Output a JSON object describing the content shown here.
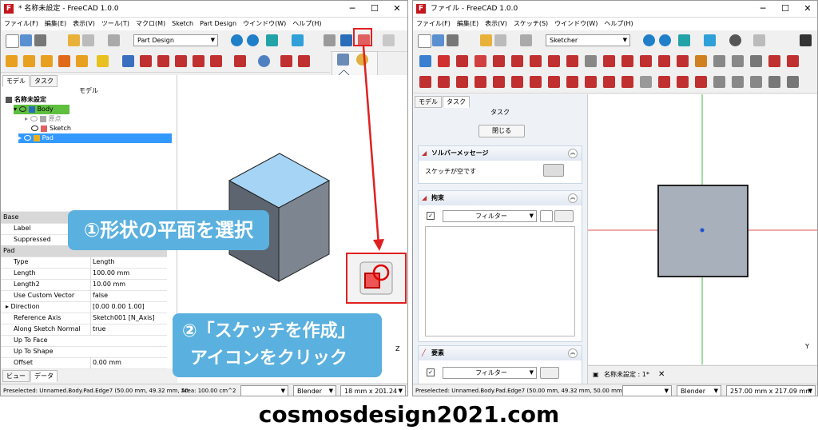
{
  "left": {
    "title": "* 名称未設定 - FreeCAD 1.0.0",
    "menu": [
      "ファイル(F)",
      "編集(E)",
      "表示(V)",
      "ツール(T)",
      "マクロ(M)",
      "Sketch",
      "Part Design",
      "ウインドウ(W)",
      "ヘルプ(H)"
    ],
    "workbench": "Part Design",
    "tabs": [
      "モデル",
      "タスク"
    ],
    "panel_title": "モデル",
    "tree": {
      "doc": "名称未設定",
      "body": "Body",
      "origin": "原点",
      "sketch": "Sketch",
      "pad": "Pad"
    },
    "props": [
      {
        "group": "Base"
      },
      {
        "k": "Label",
        "v": ""
      },
      {
        "k": "Suppressed",
        "v": ""
      },
      {
        "group": "Pad"
      },
      {
        "k": "Type",
        "v": "Length"
      },
      {
        "k": "Length",
        "v": "100.00 mm"
      },
      {
        "k": "Length2",
        "v": "10.00 mm"
      },
      {
        "k": "Use Custom Vector",
        "v": "false"
      },
      {
        "k": "Direction",
        "v": "[0.00 0.00 1.00]"
      },
      {
        "k": "Reference Axis",
        "v": "Sketch001 [N_Axis]"
      },
      {
        "k": "Along Sketch Normal",
        "v": "true"
      },
      {
        "k": "Up To Face",
        "v": ""
      },
      {
        "k": "Up To Shape",
        "v": ""
      },
      {
        "k": "Offset",
        "v": "0.00 mm"
      }
    ],
    "bottom_tabs": [
      "ビュー",
      "データ"
    ],
    "status_text": "Preselected: Unnamed.Body.Pad.Edge7 (50.00 mm, 49.32 mm, 50.",
    "area_text": "Area: 100.00 cm^2",
    "nav_style": "Blender",
    "dims": "18 mm x 201.24"
  },
  "right": {
    "title": "ファイル - FreeCAD 1.0.0",
    "menu": [
      "ファイル(F)",
      "編集(E)",
      "表示(V)",
      "スケッチ(S)",
      "ウインドウ(W)",
      "ヘルプ(H)"
    ],
    "workbench": "Sketcher",
    "tabs": [
      "モデル",
      "タスク"
    ],
    "panel_title": "タスク",
    "close_button": "閉じる",
    "solver_title": "ソルバーメッセージ",
    "solver_msg": "スケッチが空です",
    "constraints_title": "拘束",
    "filter_label": "フィルター",
    "elements_title": "要素",
    "doc_tab": "名称未設定 : 1*",
    "nav_style": "Blender",
    "dims": "257.00 mm x 217.09 mm",
    "status_text": "Preselected: Unnamed.Body.Pad.Edge7 (50.00 mm, 49.32 mm, 50.00 mm)"
  },
  "callouts": {
    "step1": "①形状の平面を選択",
    "step2_line1": "②「スケッチを作成」",
    "step2_line2": "アイコンをクリック"
  },
  "footer": "cosmosdesign2021.com",
  "colors": {
    "accent": "#5ab0de",
    "highlight": "#e02020",
    "selection": "#3399ff",
    "body_green": "#5fbf3f"
  }
}
